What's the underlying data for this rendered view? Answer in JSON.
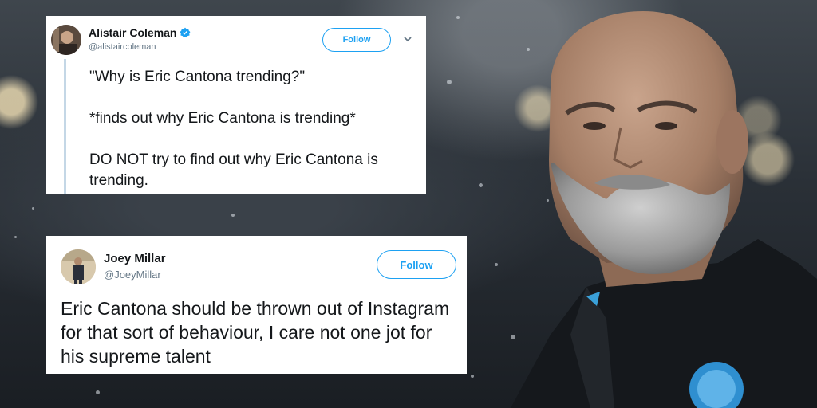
{
  "tweets": [
    {
      "name": "Alistair Coleman",
      "handle": "@alistaircoleman",
      "verified": true,
      "follow_label": "Follow",
      "text": "\"Why is Eric Cantona trending?\"\n\n*finds out why Eric Cantona is trending*\n\nDO NOT try to find out why Eric Cantona is trending."
    },
    {
      "name": "Joey Millar",
      "handle": "@JoeyMillar",
      "verified": false,
      "follow_label": "Follow",
      "text": "Eric Cantona should be thrown out of Instagram for that sort of behaviour, I care not one jot for his supreme talent"
    }
  ],
  "colors": {
    "twitter_blue": "#1da1f2",
    "handle_gray": "#657786",
    "thread_line": "#c4d7e6"
  },
  "icons": [
    "verified-badge-icon",
    "chevron-down-icon"
  ]
}
